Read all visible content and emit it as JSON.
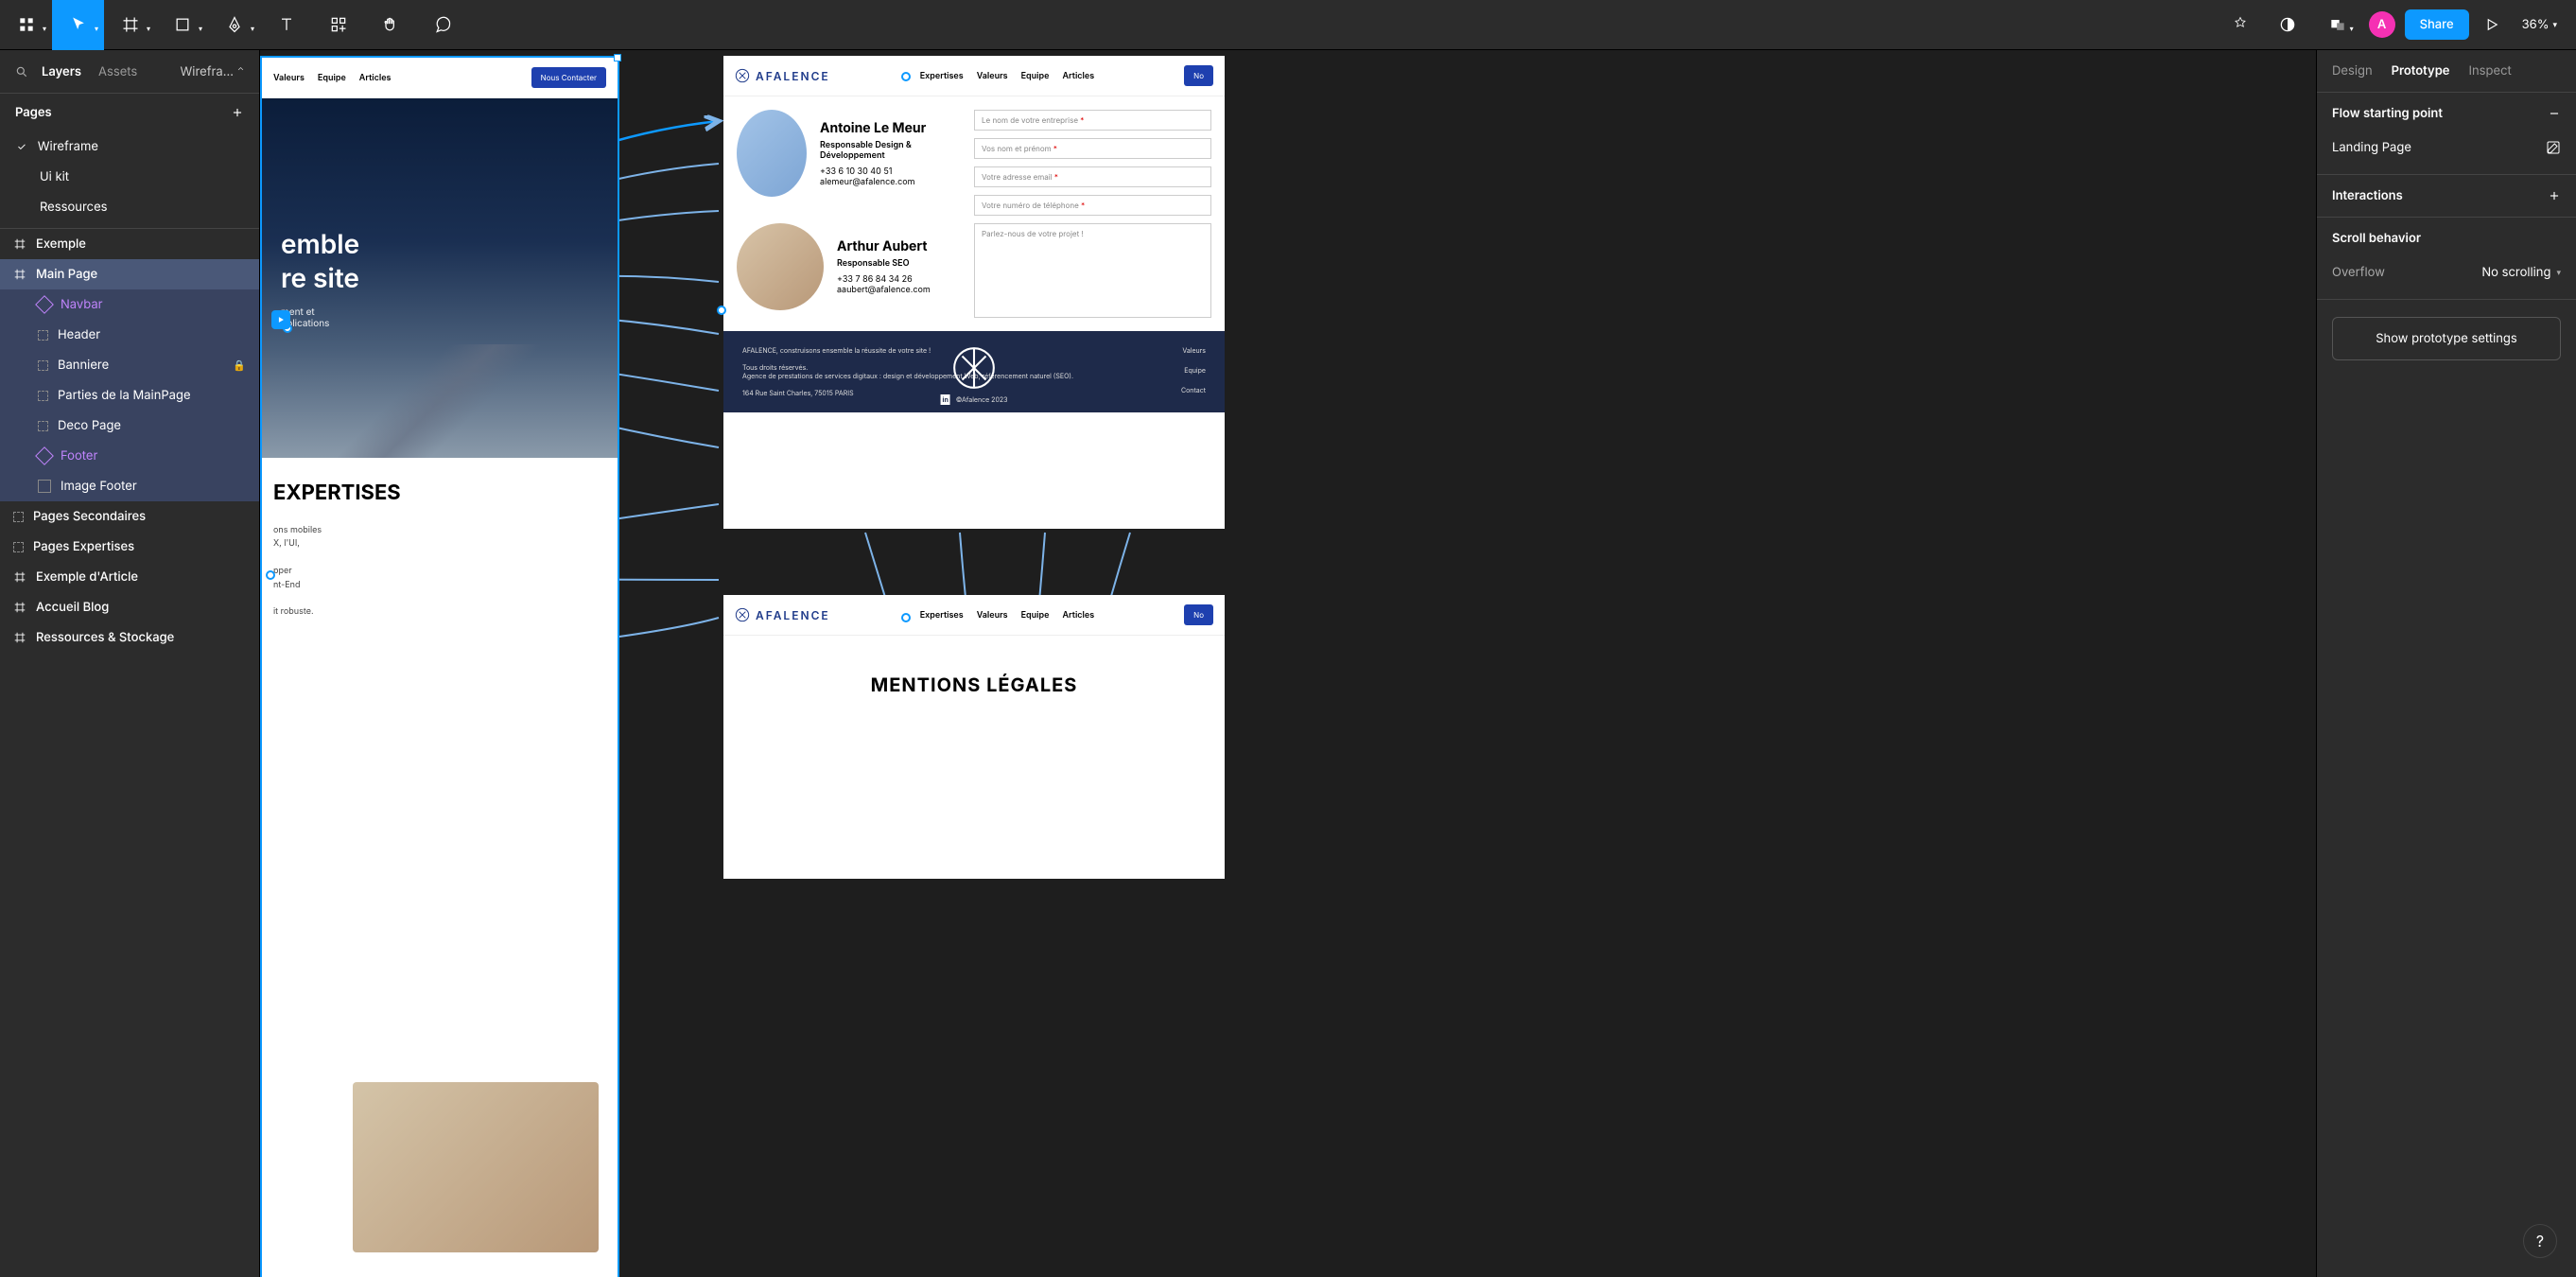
{
  "toolbar": {
    "zoom": "36%"
  },
  "user": {
    "avatar_letter": "A",
    "share_label": "Share"
  },
  "left_panel": {
    "tabs": {
      "layers": "Layers",
      "assets": "Assets"
    },
    "breadcrumb": "Wirefra…",
    "pages_label": "Pages",
    "pages": [
      {
        "name": "Wireframe",
        "selected": true
      },
      {
        "name": "Ui kit"
      },
      {
        "name": "Ressources"
      }
    ],
    "layers": [
      {
        "name": "Exemple",
        "type": "frame",
        "level": 0
      },
      {
        "name": "Main Page",
        "type": "frame",
        "level": 0,
        "selected": true
      },
      {
        "name": "Navbar",
        "type": "component",
        "level": 1,
        "purple": true,
        "group": true
      },
      {
        "name": "Header",
        "type": "group",
        "level": 1,
        "group": true
      },
      {
        "name": "Banniere",
        "type": "group",
        "level": 1,
        "locked": true,
        "group": true
      },
      {
        "name": "Parties de la MainPage",
        "type": "group",
        "level": 1,
        "group": true
      },
      {
        "name": "Deco Page",
        "type": "group",
        "level": 1,
        "group": true
      },
      {
        "name": "Footer",
        "type": "component",
        "level": 1,
        "purple": true,
        "group": true
      },
      {
        "name": "Image Footer",
        "type": "image",
        "level": 1,
        "group": true
      },
      {
        "name": "Pages Secondaires",
        "type": "group",
        "level": 0
      },
      {
        "name": "Pages Expertises",
        "type": "group",
        "level": 0
      },
      {
        "name": "Exemple d'Article",
        "type": "frame",
        "level": 0
      },
      {
        "name": "Accueil Blog",
        "type": "frame",
        "level": 0
      },
      {
        "name": "Ressources & Stockage",
        "type": "frame",
        "level": 0
      }
    ]
  },
  "canvas": {
    "nav_items": [
      "Valeurs",
      "Equipe",
      "Articles"
    ],
    "nav_items_full": [
      "Expertises",
      "Valeurs",
      "Equipe",
      "Articles"
    ],
    "cta_label": "Nous Contacter",
    "cta_short": "No",
    "brand": "AFALENCE",
    "hero_line1": "emble",
    "hero_line2": "re site",
    "hero_sub1": "ment et",
    "hero_sub2": "pplications",
    "expertises": "EXPERTISES",
    "body_snippet1": "ons mobiles",
    "body_snippet2": "X, l'UI,",
    "body_snippet3": "pper",
    "body_snippet4": "nt-End",
    "body_snippet5": "it robuste.",
    "team": [
      {
        "name": "Antoine Le Meur",
        "role": "Responsable Design & Développement",
        "phone": "+33 6 10 30 40 51",
        "email": "alemeur@afalence.com"
      },
      {
        "name": "Arthur Aubert",
        "role": "Responsable SEO",
        "phone": "+33 7 86 84 34 26",
        "email": "aaubert@afalence.com"
      }
    ],
    "form": {
      "company": "Le nom de votre entreprise",
      "name": "Vos nom et prénom",
      "email": "Votre adresse email",
      "phone": "Votre numéro de téléphone",
      "message": "Parlez-nous de votre projet !"
    },
    "footer": {
      "tagline": "AFALENCE, construisons ensemble la réussite de votre site !",
      "rights": "Tous droits réservés.",
      "desc": "Agence de prestations de services digitaux : design et développement Web, référencement naturel (SEO).",
      "address": "164 Rue Saint Charles, 75015 PARIS",
      "copyright": "©Afalence 2023",
      "links": [
        "Valeurs",
        "Equipe",
        "Contact"
      ]
    },
    "legal_title": "MENTIONS LÉGALES"
  },
  "right_panel": {
    "tabs": {
      "design": "Design",
      "prototype": "Prototype",
      "inspect": "Inspect"
    },
    "flow": {
      "header": "Flow starting point",
      "value": "Landing Page"
    },
    "interactions": {
      "header": "Interactions"
    },
    "scroll": {
      "header": "Scroll behavior",
      "overflow_label": "Overflow",
      "overflow_value": "No scrolling"
    },
    "settings_btn": "Show prototype settings"
  },
  "help": "?"
}
